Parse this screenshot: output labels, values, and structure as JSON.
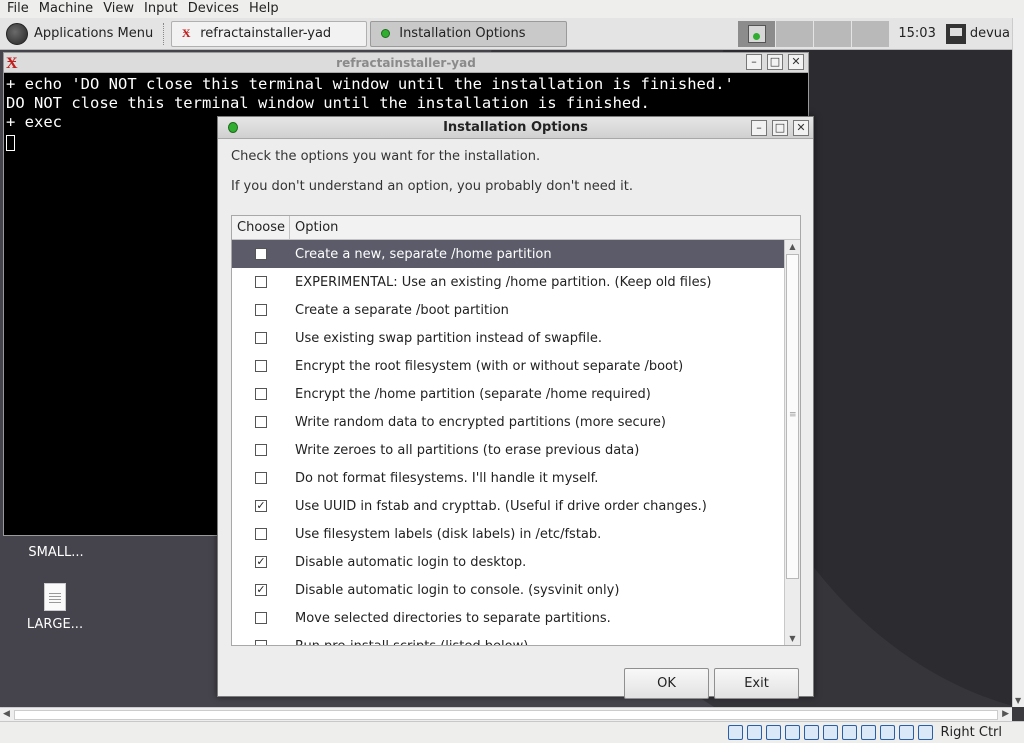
{
  "vbox_menu": [
    "File",
    "Machine",
    "View",
    "Input",
    "Devices",
    "Help"
  ],
  "panel": {
    "app_menu_label": "Applications Menu",
    "tasks": [
      {
        "label": "refractainstaller-yad",
        "active": false
      },
      {
        "label": "Installation Options",
        "active": true
      }
    ],
    "clock": "15:03",
    "username": "devua"
  },
  "terminal": {
    "title": "refractainstaller-yad",
    "lines": [
      "+ echo 'DO NOT close this terminal window until the installation is finished.'",
      "DO NOT close this terminal window until the installation is finished.",
      "+ exec"
    ]
  },
  "desktop_icons": [
    {
      "label": "SMALL..."
    },
    {
      "label": "LARGE..."
    }
  ],
  "dialog": {
    "title": "Installation Options",
    "prompt_line1": "Check the options you want for the installation.",
    "prompt_line2": "If you don't understand an option, you probably don't need it.",
    "columns": {
      "choose": "Choose",
      "option": "Option"
    },
    "options": [
      {
        "label": "Create a new, separate /home partition",
        "checked": false,
        "selected": true
      },
      {
        "label": "EXPERIMENTAL: Use an existing /home partition. (Keep old files)",
        "checked": false
      },
      {
        "label": "Create a separate /boot partition",
        "checked": false
      },
      {
        "label": "Use existing swap partition instead of swapfile.",
        "checked": false
      },
      {
        "label": "Encrypt the root filesystem (with or without separate /boot)",
        "checked": false
      },
      {
        "label": "Encrypt the /home partition (separate /home required)",
        "checked": false
      },
      {
        "label": "Write random data to encrypted partitions (more secure)",
        "checked": false
      },
      {
        "label": "Write zeroes to all partitions (to erase previous data)",
        "checked": false
      },
      {
        "label": "Do not format filesystems. I'll handle it myself.",
        "checked": false
      },
      {
        "label": "Use UUID in fstab and crypttab. (Useful if drive order changes.)",
        "checked": true
      },
      {
        "label": "Use filesystem labels (disk labels) in /etc/fstab.",
        "checked": false
      },
      {
        "label": "Disable automatic login to desktop.",
        "checked": true
      },
      {
        "label": "Disable automatic login to console. (sysvinit only)",
        "checked": true
      },
      {
        "label": "Move selected directories to separate partitions.",
        "checked": false
      },
      {
        "label": "Run pre-install scripts (listed below)",
        "checked": false
      }
    ],
    "ok_label": "OK",
    "exit_label": "Exit"
  },
  "statusbar": {
    "host_key": "Right Ctrl"
  }
}
